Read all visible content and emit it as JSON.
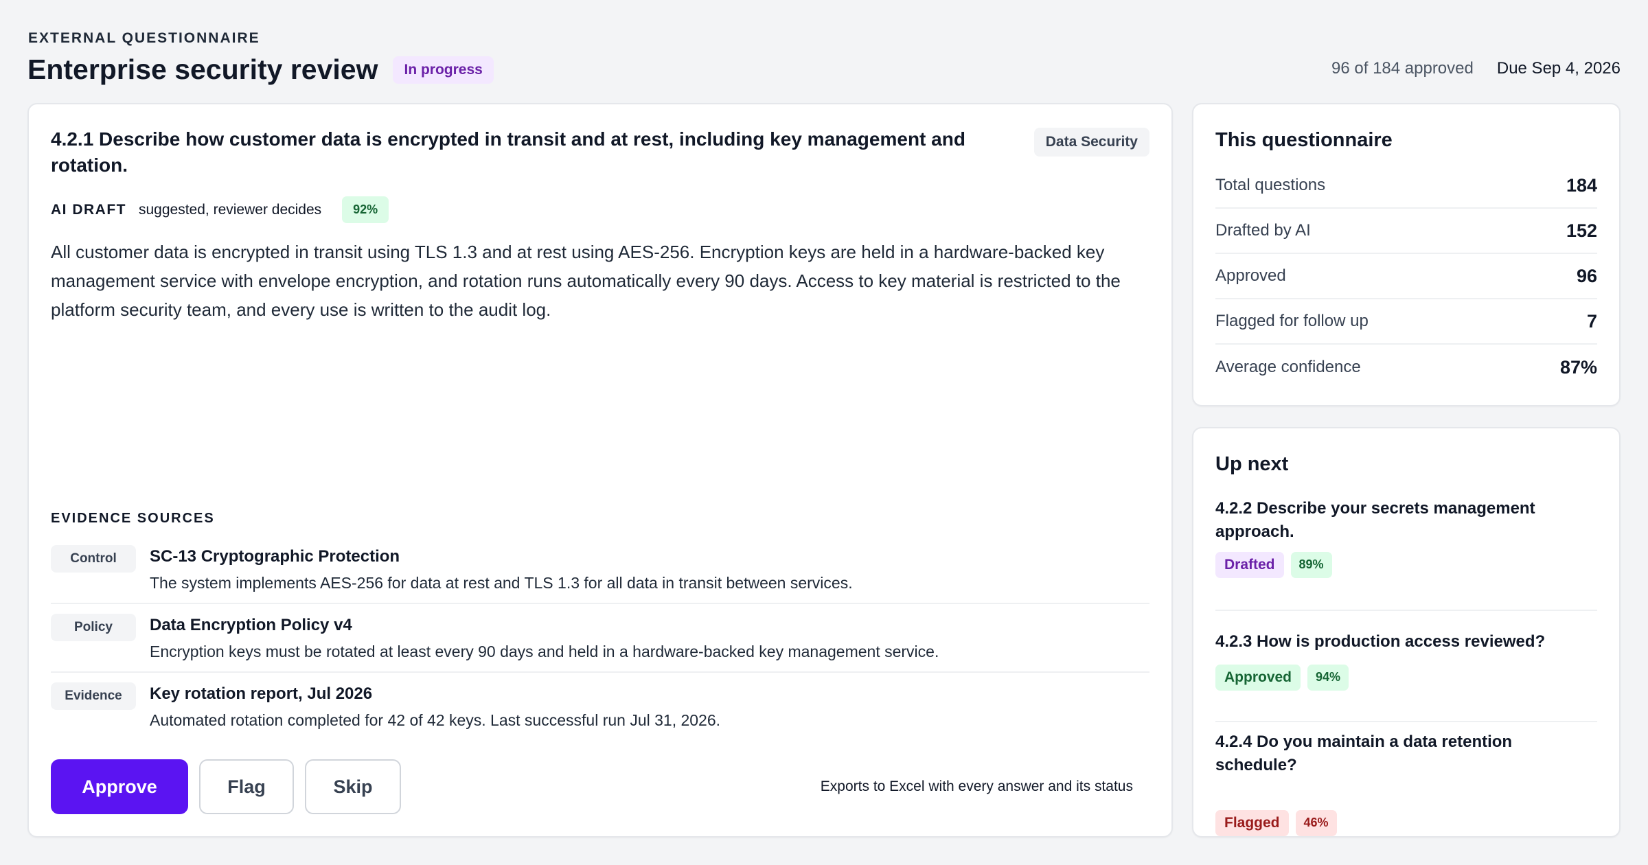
{
  "header": {
    "eyebrow": "EXTERNAL QUESTIONNAIRE",
    "title": "Enterprise security review",
    "status": "In progress",
    "approved_count": "96 of 184 approved",
    "due_date": "Due Sep 4, 2026"
  },
  "question": {
    "title": "4.2.1 Describe how customer data is encrypted in transit and at rest, including key management and rotation.",
    "category": "Data Security",
    "draft_label": "AI DRAFT",
    "draft_sub": "suggested, reviewer decides",
    "confidence": "92%",
    "answer": "All customer data is encrypted in transit using TLS 1.3 and at rest using AES-256. Encryption keys are held in a hardware-backed key management service with envelope encryption, and rotation runs automatically every 90 days. Access to key material is restricted to the platform security team, and every use is written to the audit log."
  },
  "evidence": {
    "heading": "EVIDENCE SOURCES",
    "items": [
      {
        "type": "Control",
        "title": "SC-13 Cryptographic Protection",
        "desc": "The system implements AES-256 for data at rest and TLS 1.3 for all data in transit between services."
      },
      {
        "type": "Policy",
        "title": "Data Encryption Policy v4",
        "desc": "Encryption keys must be rotated at least every 90 days and held in a hardware-backed key management service."
      },
      {
        "type": "Evidence",
        "title": "Key rotation report, Jul 2026",
        "desc": "Automated rotation completed for 42 of 42 keys. Last successful run Jul 31, 2026."
      }
    ]
  },
  "actions": {
    "approve": "Approve",
    "flag": "Flag",
    "skip": "Skip",
    "export_note": "Exports to Excel with every answer and its status"
  },
  "stats": {
    "title": "This questionnaire",
    "rows": [
      {
        "label": "Total questions",
        "value": "184"
      },
      {
        "label": "Drafted by AI",
        "value": "152"
      },
      {
        "label": "Approved",
        "value": "96"
      },
      {
        "label": "Flagged for follow up",
        "value": "7"
      },
      {
        "label": "Average confidence",
        "value": "87%"
      }
    ]
  },
  "up_next": {
    "title": "Up next",
    "items": [
      {
        "title": "4.2.2 Describe your secrets management approach.",
        "status": "Drafted",
        "confidence": "89%"
      },
      {
        "title": "4.2.3 How is production access reviewed?",
        "status": "Approved",
        "confidence": "94%"
      },
      {
        "title": "4.2.4 Do you maintain a data retention schedule?",
        "status": "Flagged",
        "confidence": "46%"
      }
    ]
  },
  "colors": {
    "accent": "#5b14f2",
    "drafted_bg": "#f3e8ff",
    "approved_bg": "#dcfce7",
    "flagged_bg": "#fee2e2"
  }
}
